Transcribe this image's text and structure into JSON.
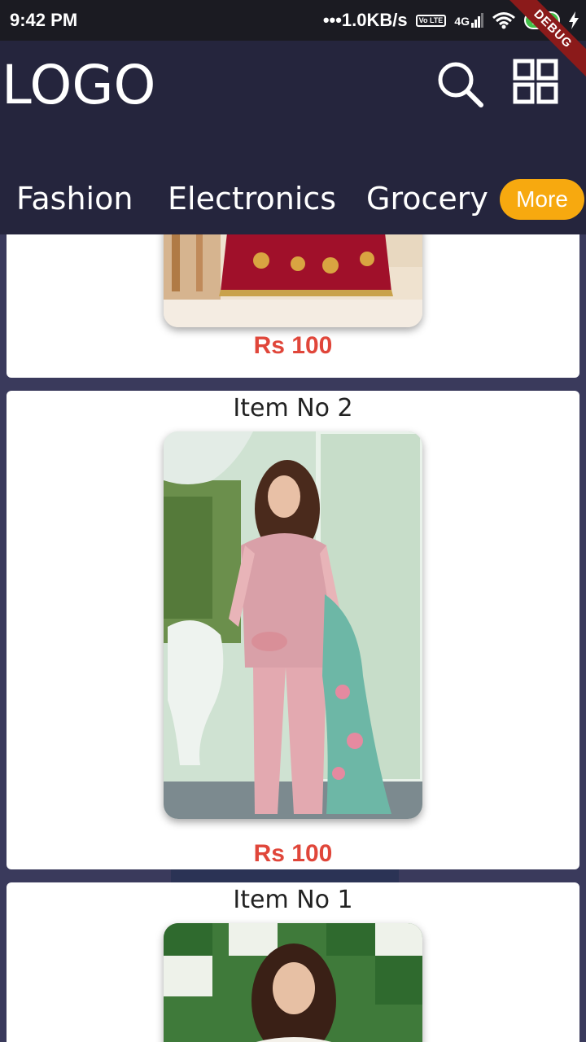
{
  "status_bar": {
    "time": "9:42 PM",
    "network_speed": "•••1.0KB/s",
    "lte": "Vo LTE",
    "signal_label": "4G",
    "battery": "100"
  },
  "debug_banner": "DEBUG",
  "app_bar": {
    "logo": "LOGO",
    "search_icon": "search-icon",
    "grid_icon": "grid-icon"
  },
  "tabs": [
    {
      "label": "Fashion"
    },
    {
      "label": "Electronics"
    },
    {
      "label": "Grocery"
    }
  ],
  "more_button": "More",
  "colors": {
    "app_bar": "#25253d",
    "status_bar": "#1b1b22",
    "more_button": "#f7a90f",
    "price": "#e0463a"
  },
  "products": [
    {
      "title": "",
      "price": "Rs 100"
    },
    {
      "title": "Item No 2",
      "price": "Rs 100"
    },
    {
      "title": "Item No 1",
      "price": ""
    }
  ]
}
